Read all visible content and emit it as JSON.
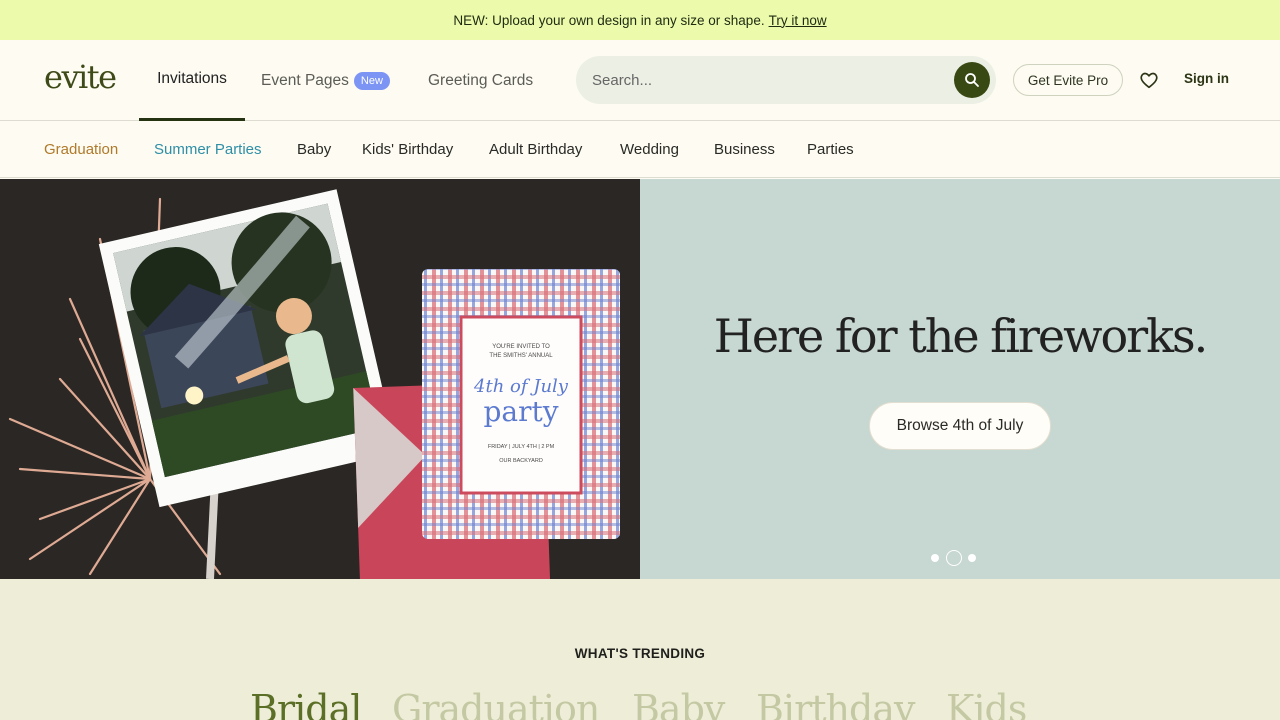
{
  "promo": {
    "text": "NEW: Upload your own design in any size or shape.",
    "link": "Try it now"
  },
  "header": {
    "logo": "evite",
    "tabs": [
      {
        "label": "Invitations"
      },
      {
        "label": "Event Pages",
        "badge": "New"
      },
      {
        "label": "Greeting Cards"
      }
    ],
    "search_placeholder": "Search...",
    "pro_button": "Get Evite Pro",
    "sign_in": "Sign in"
  },
  "categories": [
    {
      "label": "Graduation",
      "color": "#b07a2a"
    },
    {
      "label": "Summer Parties",
      "color": "#2f8fa6"
    },
    {
      "label": "Baby"
    },
    {
      "label": "Kids' Birthday"
    },
    {
      "label": "Adult Birthday"
    },
    {
      "label": "Wedding"
    },
    {
      "label": "Business"
    },
    {
      "label": "Parties"
    }
  ],
  "hero": {
    "headline": "Here for the fireworks.",
    "cta": "Browse 4th of July",
    "card": {
      "line1": "YOU'RE INVITED TO",
      "line2": "THE SMITHS' ANNUAL",
      "script": "4th of July",
      "title": "party",
      "details": "FRIDAY | JULY 4TH | 2 PM",
      "place": "OUR BACKYARD"
    }
  },
  "trending": {
    "title": "WHAT'S TRENDING",
    "items": [
      "Bridal",
      "Graduation",
      "Baby",
      "Birthday",
      "Kids"
    ]
  },
  "colors": {
    "promo_bg": "#ebfbab",
    "brand_green": "#3e4a17",
    "hero_right_bg": "#c7d7d1",
    "trending_bg": "#eeedd8"
  }
}
